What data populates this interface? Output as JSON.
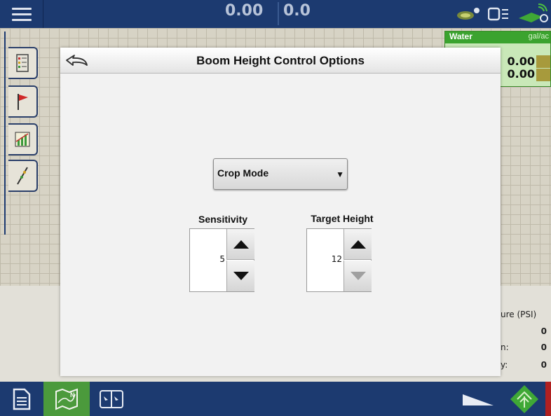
{
  "top_bar": {
    "speed_value": "0.00",
    "rate_value": "0.0"
  },
  "water_panel": {
    "title": "Water",
    "unit": "gal/ac",
    "rate_1": "0.00",
    "rate_2": "0.00"
  },
  "pressure": {
    "title": "ure (PSI)",
    "row_1_label": "",
    "row_1_value": "0",
    "row_2_label": "n:",
    "row_2_value": "0",
    "row_3_label": "y:",
    "row_3_value": "0"
  },
  "dialog": {
    "title": "Boom Height Control Options",
    "mode_select": {
      "selected": "Crop Mode"
    },
    "sensitivity": {
      "label": "Sensitivity",
      "value": "5"
    },
    "target_height": {
      "label": "Target Height",
      "value": "12"
    }
  },
  "colors": {
    "top_bar": "#1c3a70",
    "active_tab": "#4b9a3c",
    "water_header": "#3ba32f"
  }
}
